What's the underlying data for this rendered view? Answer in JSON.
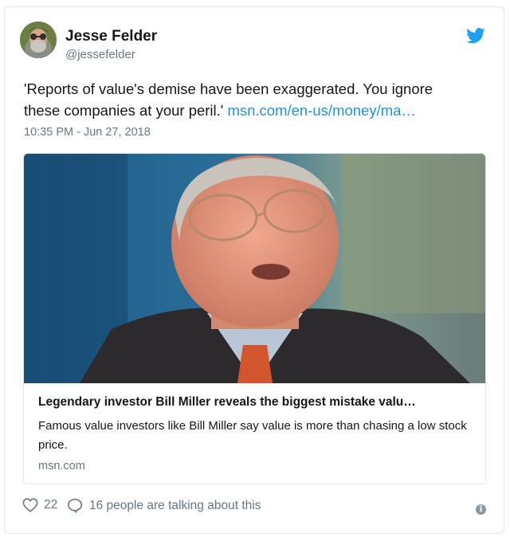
{
  "author": {
    "name": "Jesse Felder",
    "handle": "@jessefelder"
  },
  "tweet": {
    "text": "'Reports of value's demise have been exaggerated. You ignore",
    "text_line2": "these companies at your peril.' ",
    "link_text": "msn.com/en-us/money/ma…",
    "timestamp": "10:35 PM - Jun 27, 2018"
  },
  "link_card": {
    "title": "Legendary investor Bill Miller reveals the biggest mistake valu…",
    "description": "Famous value investors like Bill Miller say value is more than chasing a low stock price.",
    "domain": "msn.com"
  },
  "footer": {
    "likes": "22",
    "talking": "16 people are talking about this"
  },
  "icons": {
    "brand": "twitter-bird-icon",
    "like": "heart-icon",
    "reply": "speech-bubble-icon",
    "info": "info-icon"
  },
  "colors": {
    "link": "#1b95e0",
    "muted": "#657786",
    "border": "#e1e8ed",
    "brand": "#1da1f2"
  }
}
